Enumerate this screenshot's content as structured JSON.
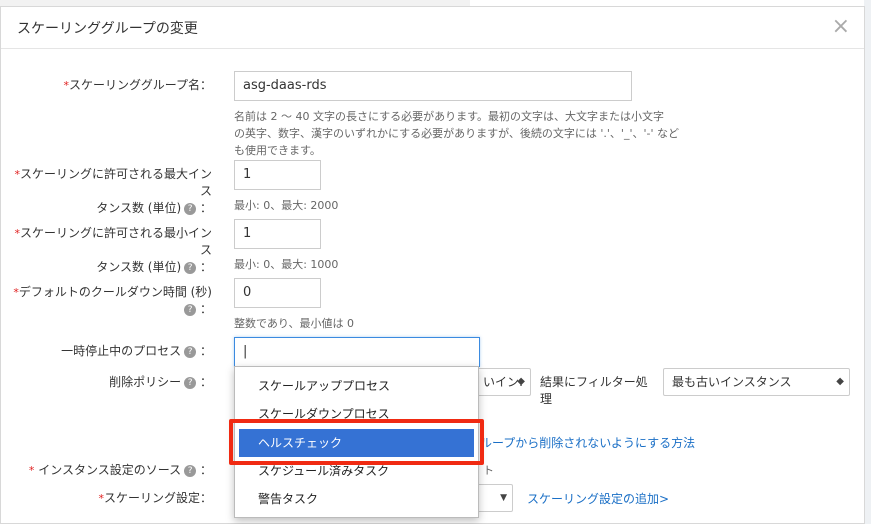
{
  "modal": {
    "title": "スケーリンググループの変更",
    "close": "×"
  },
  "fields": {
    "name": {
      "label": "スケーリンググループ名：",
      "value": "asg-daas-rds",
      "hint1": "名前は 2 ～ 40 文字の長さにする必要があります。最初の文字は、大文字または小文字",
      "hint2": "の英字、数字、漢字のいずれかにする必要がありますが、後続の文字には '.'、'_'、'-' など",
      "hint3": "も使用できます。"
    },
    "max": {
      "label1": "スケーリングに許可される最大インス",
      "label2": "タンス数 (単位)",
      "value": "1",
      "hint": "最小: 0、最大: 2000"
    },
    "min": {
      "label1": "スケーリングに許可される最小インス",
      "label2": "タンス数 (単位)",
      "value": "1",
      "hint": "最小: 0、最大: 1000"
    },
    "cooldown": {
      "label1": "デフォルトのクールダウン時間 (秒)",
      "label2": "：",
      "value": "0",
      "hint": "整数であり、最小値は 0"
    },
    "suspended": {
      "label": "一時停止中のプロセス",
      "value": "|"
    },
    "removal": {
      "label": "削除ポリシー",
      "select_partial": "いイン:",
      "filter_label": "結果にフィルター処理",
      "filter_value": "最も古いインスタンス",
      "link_partial": "ループから削除されないようにする方法"
    },
    "source": {
      "label": "インスタンス設定のソース",
      "partial": "ト"
    },
    "scaling_config": {
      "label": "スケーリング設定：",
      "link": "スケーリング設定の追加>"
    }
  },
  "dropdown": {
    "items": [
      "スケールアッププロセス",
      "スケールダウンプロセス",
      "ヘルスチェック",
      "スケジュール済みタスク",
      "警告タスク"
    ],
    "selected_index": 2
  },
  "colors": {
    "accent": "#3572d4",
    "highlight": "#f02a12",
    "required": "#e02020"
  }
}
